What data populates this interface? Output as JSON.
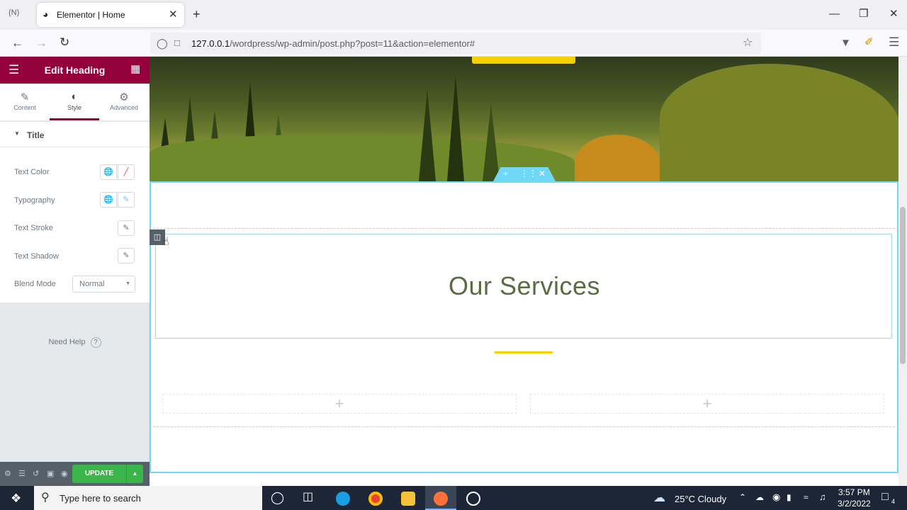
{
  "browser": {
    "tab_title": "Elementor | Home",
    "url_host": "127.0.0.1",
    "url_path": "/wordpress/wp-admin/post.php?post=11&action=elementor#"
  },
  "panel": {
    "header_title": "Edit Heading",
    "tabs": [
      {
        "label": "Content",
        "icon": "pencil-icon"
      },
      {
        "label": "Style",
        "icon": "contrast-icon"
      },
      {
        "label": "Advanced",
        "icon": "gear-icon"
      }
    ],
    "section_title": "Title",
    "controls": [
      {
        "label": "Text Color"
      },
      {
        "label": "Typography"
      },
      {
        "label": "Text Stroke"
      },
      {
        "label": "Text Shadow"
      },
      {
        "label": "Blend Mode",
        "value": "Normal"
      }
    ],
    "need_help": "Need Help",
    "update_label": "UPDATE",
    "accent_color": "#93003c"
  },
  "canvas": {
    "heading": "Our Services",
    "heading_color": "#5d6b43",
    "divider_color": "#f5d000"
  },
  "taskbar": {
    "search_placeholder": "Type here to search",
    "weather": "25°C  Cloudy",
    "time": "3:57 PM",
    "date": "3/2/2022",
    "notifications": "4"
  }
}
